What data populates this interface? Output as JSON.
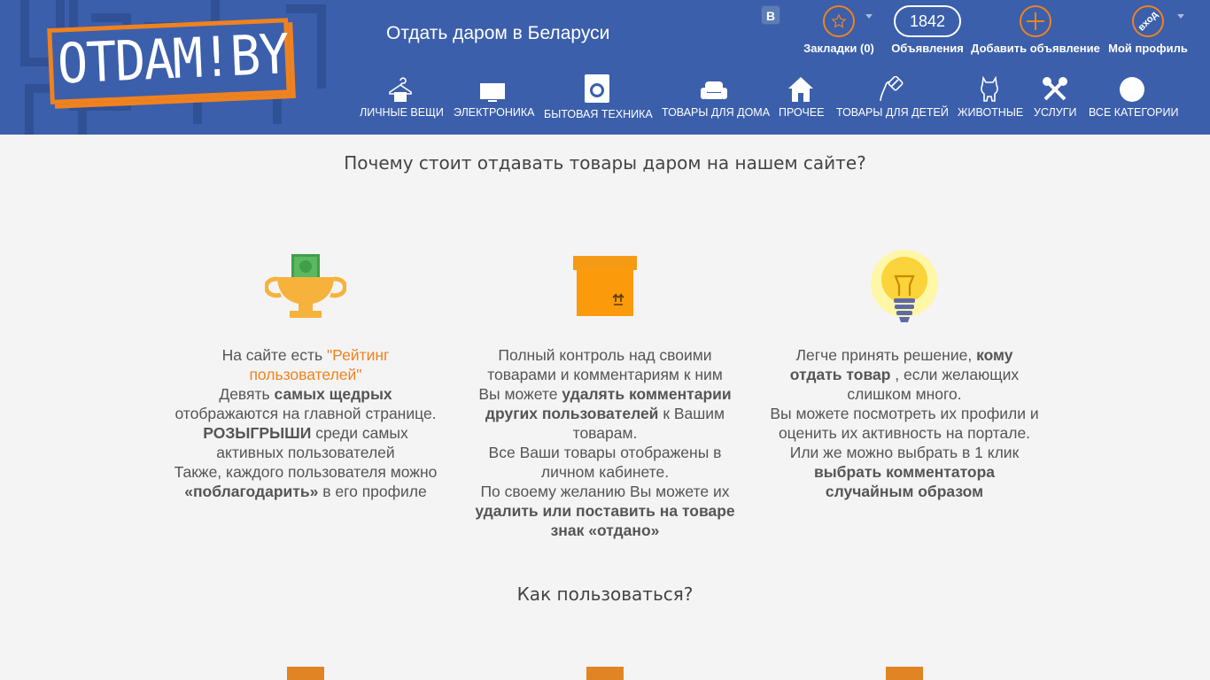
{
  "header": {
    "logo_text": "OTDAM!BY",
    "site_title": "Отдать даром в Беларуси",
    "vk_label": "B",
    "bookmarks": {
      "label": "Закладки (0)",
      "icon": "star-icon"
    },
    "ads": {
      "count": "1842",
      "label": "Объявления"
    },
    "add_ad": {
      "label": "Добавить объявление",
      "icon": "plus-icon"
    },
    "profile": {
      "label": "Мой профиль",
      "login_text": "вход"
    }
  },
  "categories": [
    {
      "label": "ЛИЧНЫЕ ВЕЩИ",
      "icon": "hanger-icon"
    },
    {
      "label": "ЭЛЕКТРОНИКА",
      "icon": "monitor-icon"
    },
    {
      "label": "БЫТОВАЯ ТЕХНИКА",
      "icon": "washing-machine-icon"
    },
    {
      "label": "ТОВАРЫ ДЛЯ ДОМА",
      "icon": "armchair-icon"
    },
    {
      "label": "ПРОЧЕЕ",
      "icon": "house-icon"
    },
    {
      "label": "ТОВАРЫ ДЛЯ ДЕТЕЙ",
      "icon": "pacifier-icon"
    },
    {
      "label": "ЖИВОТНЫЕ",
      "icon": "cat-icon"
    },
    {
      "label": "УСЛУГИ",
      "icon": "tools-icon"
    },
    {
      "label": "ВСЕ КАТЕГОРИИ",
      "icon": "all-categories-icon"
    }
  ],
  "why": {
    "title": "Почему стоит отдавать товары даром на нашем сайте?",
    "col1": {
      "p1": "На сайте есть ",
      "rating_link": "\"Рейтинг пользователей\"",
      "p2": "Девять ",
      "p2b": "самых щедрых",
      "p3": "отображаются на главной странице.",
      "p4b": "РОЗЫГРЫШИ",
      "p4": " среди самых активных пользователей",
      "p5": "Также, каждого пользователя можно",
      "p6b": "«поблагодарить»",
      "p6": " в его профиле"
    },
    "col2": {
      "p1": "Полный контроль над своими товарами и комментариям к ним",
      "p2": "Вы можете ",
      "p2b": "удалять комментарии других пользователей",
      "p2c": " к Вашим товарам.",
      "p3": "Все Ваши товары отображены в личном кабинете.",
      "p4": "По своему желанию Вы можете их",
      "p5b": "удалить или поставить на товаре знак «отдано»"
    },
    "col3": {
      "p1": "Легче принять решение, ",
      "p1b": "кому отдать товар",
      "p1c": " , если желающих слишком много.",
      "p2": "Вы можете посмотреть их профили и оценить их активность на портале.",
      "p3": "Или же можно выбрать в 1 клик",
      "p4b": "выбрать комментатора случайным образом"
    }
  },
  "how": {
    "title": "Как пользоваться?"
  }
}
